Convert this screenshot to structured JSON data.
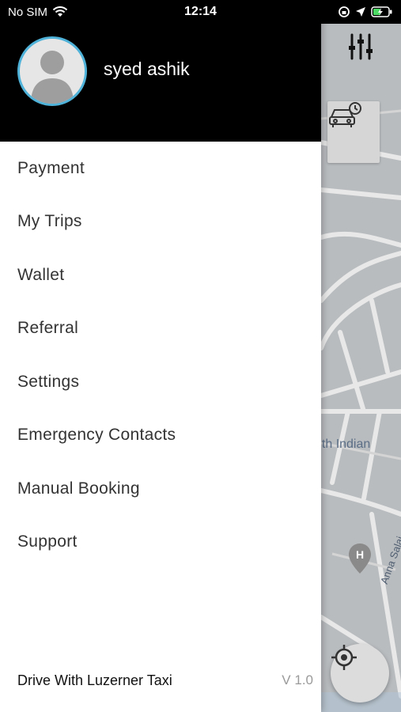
{
  "status_bar": {
    "carrier": "No SIM",
    "time": "12:14",
    "icons": [
      "wifi-icon",
      "orientation-lock-icon",
      "location-arrow-icon",
      "battery-charging-icon"
    ]
  },
  "drawer": {
    "user_name": "syed ashik",
    "menu": [
      {
        "label": "Payment"
      },
      {
        "label": "My Trips"
      },
      {
        "label": "Wallet"
      },
      {
        "label": "Referral"
      },
      {
        "label": "Settings"
      },
      {
        "label": "Emergency Contacts"
      },
      {
        "label": "Manual Booking"
      },
      {
        "label": "Support"
      }
    ],
    "footer_link": "Drive With Luzerner Taxi",
    "version": "V 1.0"
  },
  "map": {
    "labels": {
      "restaurant": "uth Indian",
      "road": "Anna Salai"
    },
    "icons": [
      "filter-icon",
      "car-schedule-icon",
      "hospital-pin-icon",
      "locate-icon"
    ]
  },
  "colors": {
    "avatar_ring": "#4fb3d9",
    "header_bg": "#000000",
    "map_bg": "#b9bcbf",
    "map_label": "#5b6e86"
  }
}
